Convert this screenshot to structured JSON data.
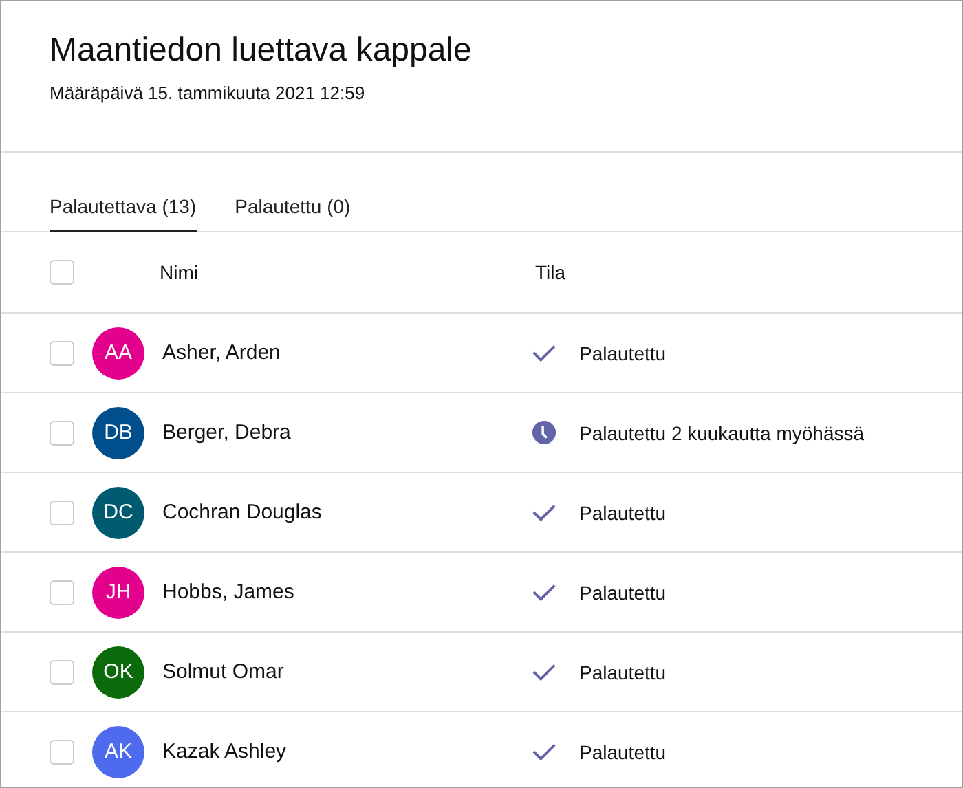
{
  "title": "Maantiedon luettava kappale",
  "due": "Määräpäivä 15. tammikuuta 2021 12:59",
  "tabs": [
    {
      "label": "Palautettava (13)",
      "selected": true
    },
    {
      "label": "Palautettu (0)",
      "selected": false
    }
  ],
  "table": {
    "columns": [
      "Nimi",
      "Tila"
    ],
    "all_checked": false,
    "rows": [
      {
        "initials": "AA",
        "color": "#e3008c",
        "name": "Asher, Arden",
        "status": "Palautettu",
        "kind": "done",
        "checked": false
      },
      {
        "initials": "DB",
        "color": "#004e8c",
        "name": "Berger, Debra",
        "status": "Palautettu 2 kuukautta myöhässä",
        "kind": "late",
        "checked": false
      },
      {
        "initials": "DC",
        "color": "#005b70",
        "name": "Cochran Douglas",
        "status": "Palautettu",
        "kind": "done",
        "checked": false
      },
      {
        "initials": "JH",
        "color": "#e3008c",
        "name": "Hobbs, James",
        "status": "Palautettu",
        "kind": "done",
        "checked": false
      },
      {
        "initials": "OK",
        "color": "#0b6a0b",
        "name": "Solmut Omar",
        "status": "Palautettu",
        "kind": "done",
        "checked": false
      },
      {
        "initials": "AK",
        "color": "#4f6bed",
        "name": "Kazak Ashley",
        "status": "Palautettu",
        "kind": "done",
        "checked": false
      }
    ]
  }
}
